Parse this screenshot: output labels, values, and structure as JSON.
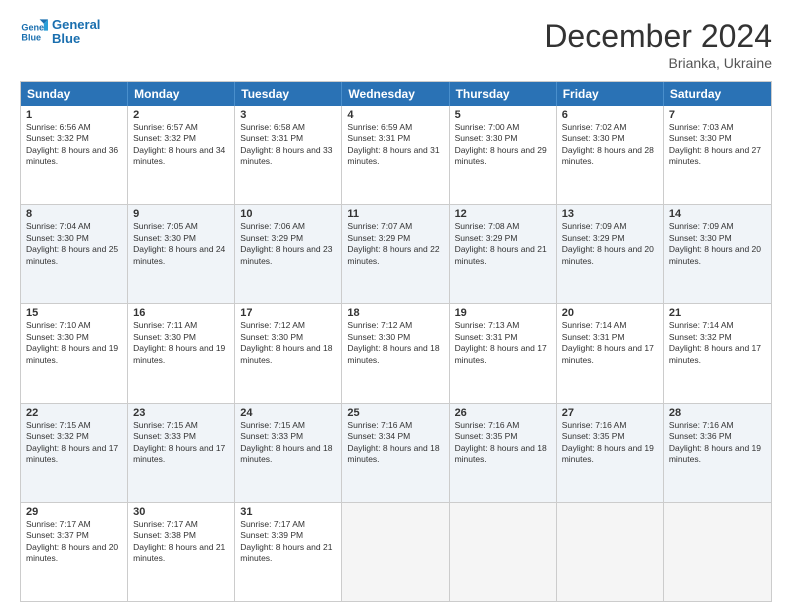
{
  "logo": {
    "line1": "General",
    "line2": "Blue"
  },
  "title": "December 2024",
  "location": "Brianka, Ukraine",
  "days": [
    "Sunday",
    "Monday",
    "Tuesday",
    "Wednesday",
    "Thursday",
    "Friday",
    "Saturday"
  ],
  "weeks": [
    [
      {
        "day": "1",
        "sunrise": "6:56 AM",
        "sunset": "3:32 PM",
        "daylight": "8 hours and 36 minutes."
      },
      {
        "day": "2",
        "sunrise": "6:57 AM",
        "sunset": "3:32 PM",
        "daylight": "8 hours and 34 minutes."
      },
      {
        "day": "3",
        "sunrise": "6:58 AM",
        "sunset": "3:31 PM",
        "daylight": "8 hours and 33 minutes."
      },
      {
        "day": "4",
        "sunrise": "6:59 AM",
        "sunset": "3:31 PM",
        "daylight": "8 hours and 31 minutes."
      },
      {
        "day": "5",
        "sunrise": "7:00 AM",
        "sunset": "3:30 PM",
        "daylight": "8 hours and 29 minutes."
      },
      {
        "day": "6",
        "sunrise": "7:02 AM",
        "sunset": "3:30 PM",
        "daylight": "8 hours and 28 minutes."
      },
      {
        "day": "7",
        "sunrise": "7:03 AM",
        "sunset": "3:30 PM",
        "daylight": "8 hours and 27 minutes."
      }
    ],
    [
      {
        "day": "8",
        "sunrise": "7:04 AM",
        "sunset": "3:30 PM",
        "daylight": "8 hours and 25 minutes."
      },
      {
        "day": "9",
        "sunrise": "7:05 AM",
        "sunset": "3:30 PM",
        "daylight": "8 hours and 24 minutes."
      },
      {
        "day": "10",
        "sunrise": "7:06 AM",
        "sunset": "3:29 PM",
        "daylight": "8 hours and 23 minutes."
      },
      {
        "day": "11",
        "sunrise": "7:07 AM",
        "sunset": "3:29 PM",
        "daylight": "8 hours and 22 minutes."
      },
      {
        "day": "12",
        "sunrise": "7:08 AM",
        "sunset": "3:29 PM",
        "daylight": "8 hours and 21 minutes."
      },
      {
        "day": "13",
        "sunrise": "7:09 AM",
        "sunset": "3:29 PM",
        "daylight": "8 hours and 20 minutes."
      },
      {
        "day": "14",
        "sunrise": "7:09 AM",
        "sunset": "3:30 PM",
        "daylight": "8 hours and 20 minutes."
      }
    ],
    [
      {
        "day": "15",
        "sunrise": "7:10 AM",
        "sunset": "3:30 PM",
        "daylight": "8 hours and 19 minutes."
      },
      {
        "day": "16",
        "sunrise": "7:11 AM",
        "sunset": "3:30 PM",
        "daylight": "8 hours and 19 minutes."
      },
      {
        "day": "17",
        "sunrise": "7:12 AM",
        "sunset": "3:30 PM",
        "daylight": "8 hours and 18 minutes."
      },
      {
        "day": "18",
        "sunrise": "7:12 AM",
        "sunset": "3:30 PM",
        "daylight": "8 hours and 18 minutes."
      },
      {
        "day": "19",
        "sunrise": "7:13 AM",
        "sunset": "3:31 PM",
        "daylight": "8 hours and 17 minutes."
      },
      {
        "day": "20",
        "sunrise": "7:14 AM",
        "sunset": "3:31 PM",
        "daylight": "8 hours and 17 minutes."
      },
      {
        "day": "21",
        "sunrise": "7:14 AM",
        "sunset": "3:32 PM",
        "daylight": "8 hours and 17 minutes."
      }
    ],
    [
      {
        "day": "22",
        "sunrise": "7:15 AM",
        "sunset": "3:32 PM",
        "daylight": "8 hours and 17 minutes."
      },
      {
        "day": "23",
        "sunrise": "7:15 AM",
        "sunset": "3:33 PM",
        "daylight": "8 hours and 17 minutes."
      },
      {
        "day": "24",
        "sunrise": "7:15 AM",
        "sunset": "3:33 PM",
        "daylight": "8 hours and 18 minutes."
      },
      {
        "day": "25",
        "sunrise": "7:16 AM",
        "sunset": "3:34 PM",
        "daylight": "8 hours and 18 minutes."
      },
      {
        "day": "26",
        "sunrise": "7:16 AM",
        "sunset": "3:35 PM",
        "daylight": "8 hours and 18 minutes."
      },
      {
        "day": "27",
        "sunrise": "7:16 AM",
        "sunset": "3:35 PM",
        "daylight": "8 hours and 19 minutes."
      },
      {
        "day": "28",
        "sunrise": "7:16 AM",
        "sunset": "3:36 PM",
        "daylight": "8 hours and 19 minutes."
      }
    ],
    [
      {
        "day": "29",
        "sunrise": "7:17 AM",
        "sunset": "3:37 PM",
        "daylight": "8 hours and 20 minutes."
      },
      {
        "day": "30",
        "sunrise": "7:17 AM",
        "sunset": "3:38 PM",
        "daylight": "8 hours and 21 minutes."
      },
      {
        "day": "31",
        "sunrise": "7:17 AM",
        "sunset": "3:39 PM",
        "daylight": "8 hours and 21 minutes."
      },
      null,
      null,
      null,
      null
    ]
  ]
}
